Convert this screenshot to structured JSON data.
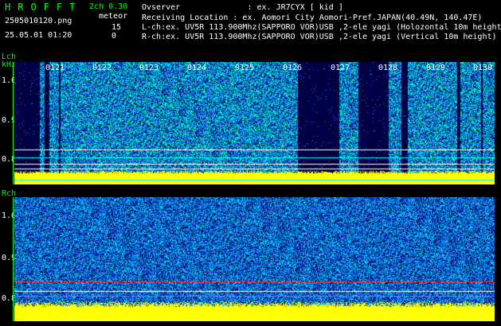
{
  "header": {
    "logo": "HROFFT",
    "version": "2ch 0.30",
    "filename": "2505010120.png",
    "mode": "meteor",
    "count_l": "15",
    "datetime": "25.05.01 01:20",
    "count_r": "0",
    "info_lines": [
      "Ovserver              : ex. JR7CYX [ kid ]",
      "Receiving Location : ex. Aomori City Aomori-Pref.JAPAN(40.49N, 140.47E)",
      "L-ch:ex. UV5R 113.900Mhz(SAPPORO VOR)USB ,2-ele yagi (Holozontal 10m height",
      "R-ch:ex. UV5R 113.900Mhz(SAPPORO VOR)USB ,2-ele yagi (Vertical 10m height)"
    ]
  },
  "lch": {
    "label": "Lch",
    "unit": "kHz",
    "yticks": [
      "1.0",
      "0.9",
      "0.8"
    ]
  },
  "rch": {
    "label": "Rch",
    "yticks": [
      "1.0",
      "0.9",
      "0.8"
    ]
  },
  "time_labels": [
    "0121",
    "0122",
    "0123",
    "0124",
    "0125",
    "0126",
    "0127",
    "0128",
    "0129",
    "0130"
  ],
  "colors": {
    "text_green": "#00ff00",
    "text_white": "#ffffff",
    "noise_yellow": "#ffff00",
    "background": "#000000"
  }
}
